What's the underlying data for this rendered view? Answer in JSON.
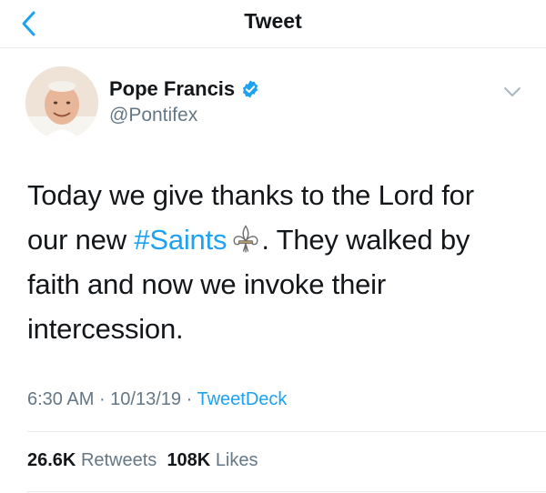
{
  "header": {
    "title": "Tweet",
    "back_icon": "chevron-left-icon"
  },
  "author": {
    "name": "Pope Francis",
    "handle": "@Pontifex",
    "verified": true
  },
  "tweet": {
    "text_part1": "Today we give thanks to the Lord for our new ",
    "hashtag": "#Saints",
    "emoji": "fleur-de-lis-icon",
    "text_part2": ". They walked by faith and now we invoke their intercession."
  },
  "meta": {
    "time": "6:30 AM",
    "sep1": " · ",
    "date": "10/13/19",
    "sep2": " · ",
    "source": "TweetDeck"
  },
  "stats": {
    "retweets_count": "26.6K",
    "retweets_label": "Retweets",
    "likes_count": "108K",
    "likes_label": "Likes"
  },
  "colors": {
    "accent": "#1da1f2",
    "secondary_text": "#657786",
    "primary_text": "#14171a",
    "divider": "#e6ecf0"
  }
}
